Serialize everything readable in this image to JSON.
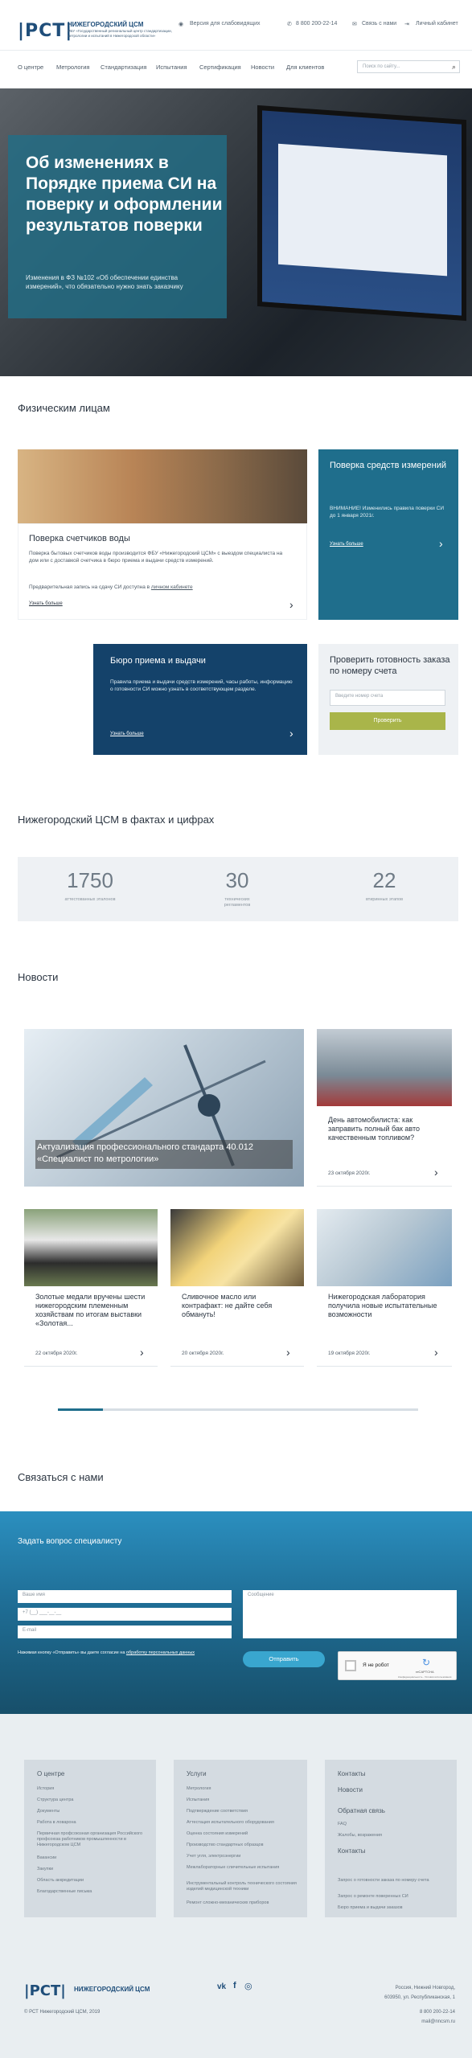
{
  "header": {
    "logo_mark": "|РСТ|",
    "logo_name": "НИЖЕГОРОДСКИЙ ЦСМ",
    "logo_desc": "ФБУ «Государственный региональный центр стандартизации, метрологии и испытаний в Нижегородской области»",
    "vision_link": "Версия для слабовидящих",
    "phone": "8 800 200-22-14",
    "contact_link": "Связь с нами",
    "cabinet_link": "Личный кабинет"
  },
  "nav": {
    "items": [
      "О центре",
      "Метрология",
      "Стандартизация",
      "Испытания",
      "Сертификация",
      "Новости",
      "Для клиентов"
    ],
    "search_placeholder": "Поиск по сайту..."
  },
  "hero": {
    "title": "Об изменениях в Порядке приема СИ на поверку и оформлении результатов поверки",
    "subtitle": "Изменения в ФЗ №102 «Об обеспечении единства измерений», что обязательно нужно знать заказчику"
  },
  "individuals": {
    "heading": "Физическим лицам",
    "meter_title": "Поверка счетчиков воды",
    "meter_text": "Поверка бытовых счетчиков воды производится ФБУ «Нижегородский ЦСМ» с выездом специалиста на дом или с доставкой счетчика в бюро приема и выдачи средств измерений.",
    "meter_note_prefix": "Предварительная запись на сдачу СИ доступна в ",
    "meter_note_link": "личном кабинете",
    "meter_more": "Узнать больше",
    "verify_title": "Поверка средств измерений",
    "verify_text": "ВНИМАНИЕ! Изменились правила поверки СИ до 1 января 2021г.",
    "verify_more": "Узнать больше",
    "bureau_title": "Бюро приема и выдачи",
    "bureau_text": "Правила приема и выдачи средств измерений, часы работы, информацию о готовности СИ можно узнать в соответствующем разделе.",
    "bureau_more": "Узнать больше",
    "check_title": "Проверить готовность заказа по номеру счета",
    "check_placeholder": "Введите номер счета",
    "check_button": "Проверить"
  },
  "facts": {
    "heading": "Нижегородский ЦСМ в фактах и цифрах",
    "items": [
      {
        "value": "1750",
        "label": "аттестованных эталонов"
      },
      {
        "value": "30",
        "label": "технических регламентов"
      },
      {
        "value": "22",
        "label": "втиринных этапов"
      }
    ]
  },
  "news": {
    "heading": "Новости",
    "featured_title": "Актуализация профессионального стандарта 40.012 «Специалист по метрологии»",
    "items": [
      {
        "title": "День автомобилиста: как заправить полный бак авто качественным топливом?",
        "date": "23 октября 2020г."
      },
      {
        "title": "Золотые медали вручены шести нижегородским племенным хозяйствам по итогам выставки «Золотая...",
        "date": "22 октября 2020г."
      },
      {
        "title": "Сливочное масло или контрафакт: не дайте себя обмануть!",
        "date": "20 октября 2020г."
      },
      {
        "title": "Нижегородская лаборатория получила новые испытательные возможности",
        "date": "19 октября 2020г."
      }
    ]
  },
  "contact": {
    "heading": "Связаться с нами",
    "form_title": "Задать вопрос специалисту",
    "name_placeholder": "Ваше имя",
    "phone_placeholder": "+7 (__) ___-__-__",
    "email_placeholder": "E-mail",
    "message_placeholder": "Сообщение",
    "consent_prefix": "Нажимая кнопку «Отправить» вы даете согласие на ",
    "consent_link": "обработку персональных данных",
    "submit": "Отправить",
    "captcha_label": "Я не робот",
    "captcha_brand": "reCAPTCHA",
    "captcha_terms": "Конфиденциальность - Условия использования"
  },
  "footer": {
    "col1_head": "О центре",
    "col1_links": [
      "История",
      "Структура центра",
      "Документы",
      "Работа в ловарона",
      "Первичная профсоюзная организация Российского профсоюза работников промышленности в Нижегородском ЦСМ",
      "Вакансии",
      "Закупки",
      "Область аккредитации",
      "Благодарственные письма"
    ],
    "col2_head": "Услуги",
    "col2_links": [
      "Метрология",
      "Испытания",
      "Подтверждение соответствия",
      "Аттестация испытательного оборудования",
      "Оценка состояния измерений",
      "Производство стандартных образцов",
      "Учет угля, электроэнергии",
      "Межлабораторные сличительные испытания",
      "Инструментальный контроль технического состояния изделий медицинской техники",
      "Ремонт сложно-механических приборов"
    ],
    "col3_heads": [
      "Контакты",
      "Новости",
      "Обратная связь",
      "FAQ",
      "Жалобы, возражения",
      "Контакты"
    ],
    "col3_links": [
      "Запрос о готовности заказа по номеру счета",
      "Запрос о ремонте поверенных СИ",
      "Бюро приема и выдачи заказов"
    ],
    "logo": "|РСТ|",
    "logo_name": "НИЖЕГОРОДСКИЙ ЦСМ",
    "copyright": "© РСТ Нижегородский ЦСМ, 2019",
    "address_line1": "Россия, Нижний Новгород,",
    "address_line2": "603950, ул. Республиканская, 1",
    "phone": "8 800 200-22-14",
    "email": "mail@nncsm.ru",
    "social": [
      "vk",
      "f",
      "◎"
    ]
  }
}
